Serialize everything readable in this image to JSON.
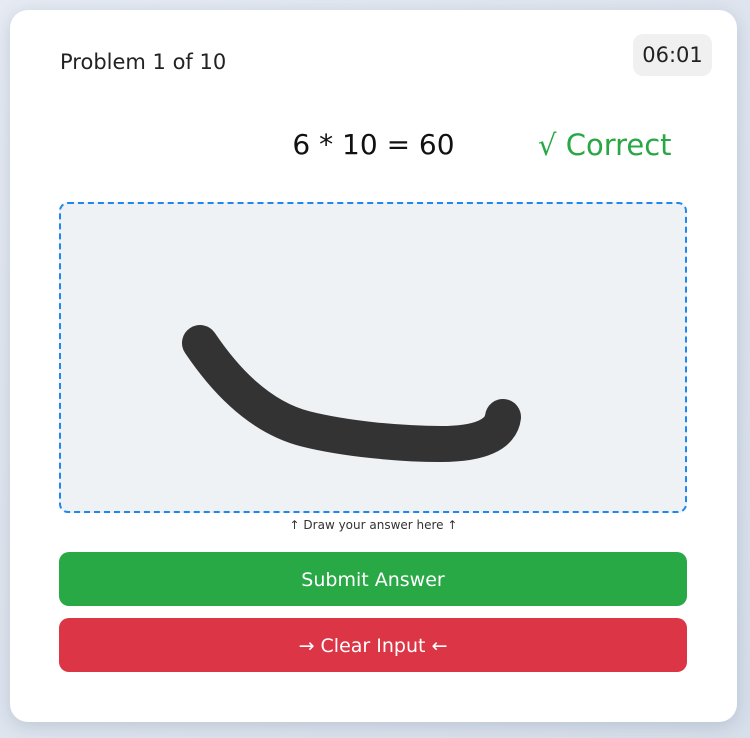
{
  "header": {
    "problem_counter": "Problem 1 of 10",
    "timer": "06:01"
  },
  "problem": {
    "equation": "6 * 10 = 60",
    "result": "√ Correct"
  },
  "canvas": {
    "hint": "↑ Draw your answer here ↑"
  },
  "actions": {
    "submit_label": "Submit Answer",
    "clear_label": "→ Clear Input ←"
  },
  "colors": {
    "correct": "#28a745",
    "submit": "#28a946",
    "clear": "#dc3546",
    "canvas_border": "#1e88f0",
    "stroke": "#333333"
  }
}
